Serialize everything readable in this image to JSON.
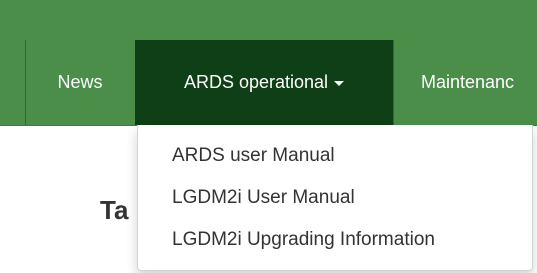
{
  "colors": {
    "navbar_green": "#4a8e4a",
    "active_tab_dark_green": "#0f3f16",
    "dropdown_text": "#333333"
  },
  "nav": {
    "items": [
      {
        "label": "News"
      },
      {
        "label": "ARDS operational"
      },
      {
        "label": "Maintenanc"
      }
    ],
    "active": "ARDS operational"
  },
  "dropdown": {
    "items": [
      {
        "label": "ARDS user Manual"
      },
      {
        "label": "LGDM2i User Manual"
      },
      {
        "label": "LGDM2i Upgrading Information"
      }
    ]
  },
  "main": {
    "heading_fragment": "Ta"
  }
}
